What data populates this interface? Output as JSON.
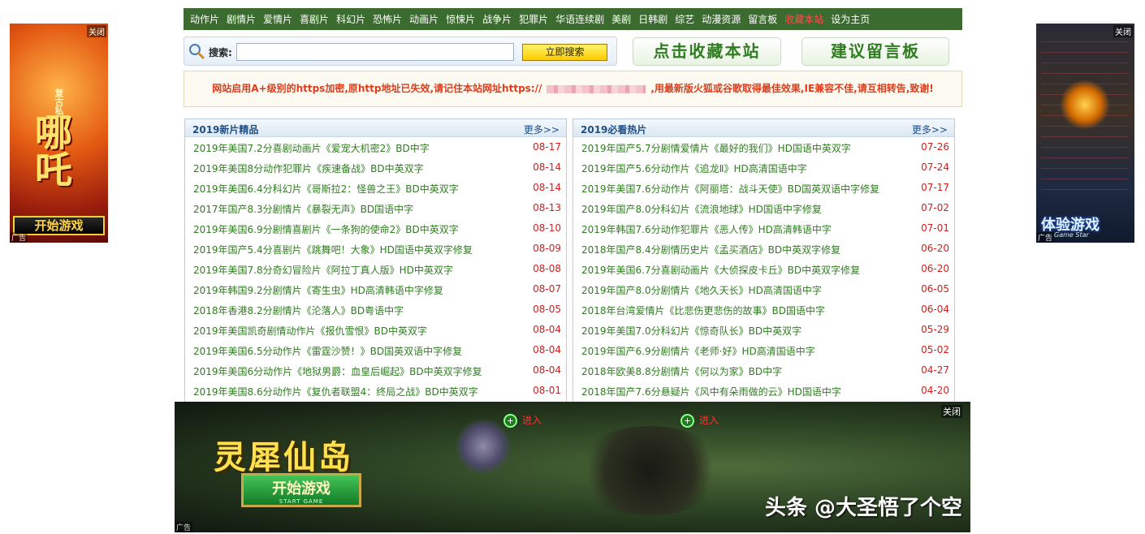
{
  "nav": {
    "items": [
      "动作片",
      "剧情片",
      "爱情片",
      "喜剧片",
      "科幻片",
      "恐怖片",
      "动画片",
      "惊悚片",
      "战争片",
      "犯罪片",
      "华语连续剧",
      "美剧",
      "日韩剧",
      "综艺",
      "动漫资源",
      "留言板",
      "收藏本站",
      "设为主页"
    ]
  },
  "search": {
    "label": "搜索:",
    "placeholder": "",
    "button": "立即搜索"
  },
  "buttons": {
    "favorite": "点击收藏本站",
    "message_board": "建议留言板"
  },
  "notice": {
    "before": "网站启用A+级别的https加密,原http地址已失效,请记住本站网址https://",
    "after": ",用最新版火狐或谷歌取得最佳效果,IE兼容不佳,请互相转告,致谢!"
  },
  "panels": {
    "left": {
      "title": "2019新片精品",
      "more": "更多>>",
      "rows": [
        {
          "title": "2019年美国7.2分喜剧动画片《爱宠大机密2》BD中字",
          "date": "08-17"
        },
        {
          "title": "2019年美国8分动作犯罪片《疾速备战》BD中英双字",
          "date": "08-14"
        },
        {
          "title": "2019年美国6.4分科幻片《哥斯拉2：怪兽之王》BD中英双字",
          "date": "08-14"
        },
        {
          "title": "2017年国产8.3分剧情片《暴裂无声》BD国语中字",
          "date": "08-13"
        },
        {
          "title": "2019年美国6.9分剧情喜剧片《一条狗的使命2》BD中英双字",
          "date": "08-10"
        },
        {
          "title": "2019年国产5.4分喜剧片《跳舞吧！大象》HD国语中英双字修复",
          "date": "08-09"
        },
        {
          "title": "2019年美国7.8分奇幻冒险片《阿拉丁真人版》HD中英双字",
          "date": "08-08"
        },
        {
          "title": "2019年韩国9.2分剧情片《寄生虫》HD高清韩语中字修复",
          "date": "08-07"
        },
        {
          "title": "2018年香港8.2分剧情片《沦落人》BD粤语中字",
          "date": "08-05"
        },
        {
          "title": "2019年美国凯奇剧情动作片《报仇雪恨》BD中英双字",
          "date": "08-04"
        },
        {
          "title": "2019年美国6.5分动作片《雷霆沙赞！》BD国英双语中字修复",
          "date": "08-04"
        },
        {
          "title": "2019年美国6分动作片《地狱男爵：血皇后崛起》BD中英双字修复",
          "date": "08-04"
        },
        {
          "title": "2019年美国8.6分动作片《复仇者联盟4：终局之战》BD中英双字",
          "date": "08-01"
        }
      ]
    },
    "right": {
      "title": "2019必看热片",
      "more": "更多>>",
      "rows": [
        {
          "title": "2019年国产5.7分剧情爱情片《最好的我们》HD国语中英双字",
          "date": "07-26"
        },
        {
          "title": "2019年国产5.6分动作片《追龙Ⅱ》HD高清国语中字",
          "date": "07-24"
        },
        {
          "title": "2019年美国7.6分动作片《阿丽塔：战斗天使》BD国英双语中字修复",
          "date": "07-17"
        },
        {
          "title": "2019年国产8.0分科幻片《流浪地球》HD国语中字修复",
          "date": "07-02"
        },
        {
          "title": "2019年韩国7.6分动作犯罪片《恶人传》HD高清韩语中字",
          "date": "07-01"
        },
        {
          "title": "2018年国产8.4分剧情历史片《孟买酒店》BD中英双字修复",
          "date": "06-20"
        },
        {
          "title": "2019年美国6.7分喜剧动画片《大侦探皮卡丘》BD中英双字修复",
          "date": "06-20"
        },
        {
          "title": "2019年国产8.0分剧情片《地久天长》HD高清国语中字",
          "date": "06-05"
        },
        {
          "title": "2018年台湾爱情片《比悲伤更悲伤的故事》BD国语中字",
          "date": "06-04"
        },
        {
          "title": "2019年美国7.0分科幻片《惊奇队长》BD中英双字",
          "date": "05-29"
        },
        {
          "title": "2019年国产6.9分剧情片《老师·好》HD高清国语中字",
          "date": "05-02"
        },
        {
          "title": "2018年欧美8.8分剧情片《何以为家》BD中字",
          "date": "04-27"
        },
        {
          "title": "2018年国产7.6分悬疑片《风中有朵雨做的云》HD国语中字",
          "date": "04-20"
        }
      ]
    }
  },
  "ads": {
    "left": {
      "close": "关闭",
      "tag": "广告",
      "word": "哪吒",
      "badge": "复古私服",
      "cta": "开始游戏"
    },
    "right": {
      "close": "关闭",
      "tag": "广告",
      "cta": "体验游戏",
      "sub": "Game Star"
    },
    "banner": {
      "close": "关闭",
      "tag": "广告",
      "title": "灵犀仙岛",
      "cta": "开始游戏",
      "cta_sub": "START GAME",
      "enter1": "进入",
      "enter2": "进入"
    }
  },
  "watermark": "头条 @大圣悟了个空",
  "colors": {
    "nav_bg": "#3b6b2f",
    "link_green": "#2f7d20",
    "date_red": "#d81b1b",
    "notice_red": "#e03b1b"
  }
}
